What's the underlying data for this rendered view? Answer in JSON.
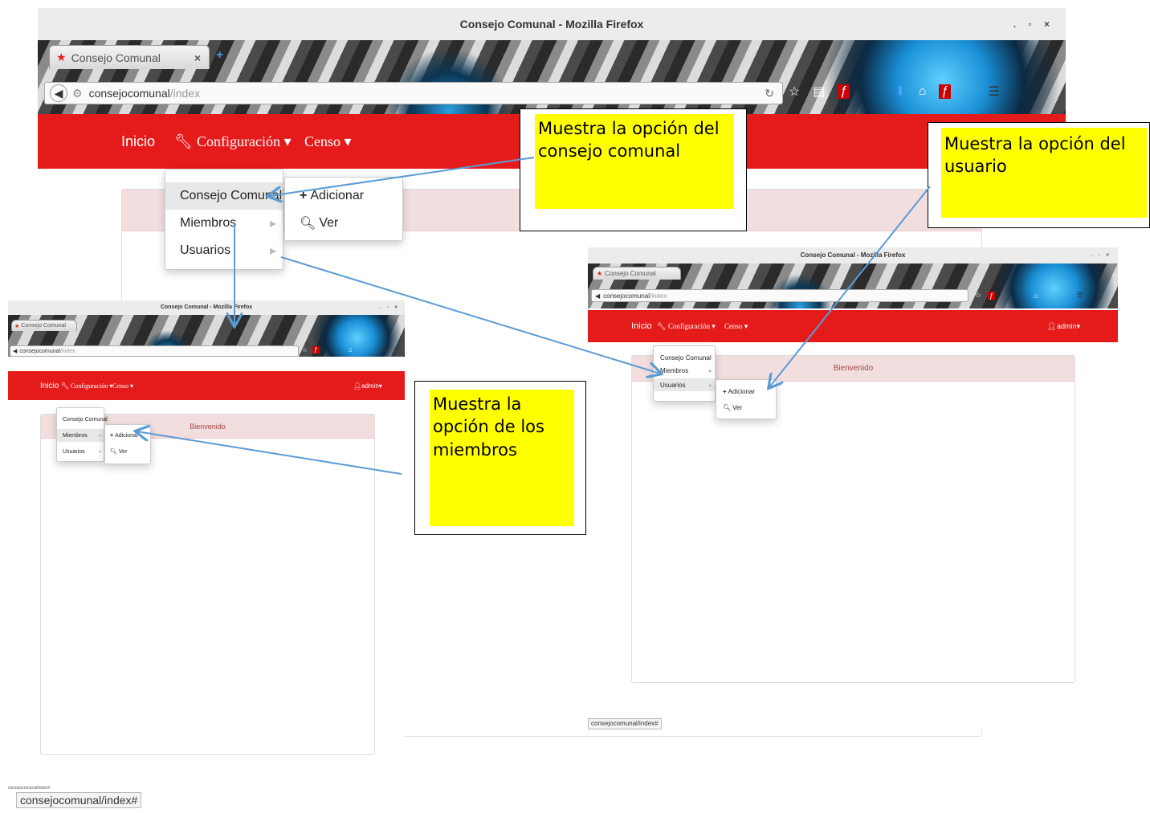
{
  "browser": {
    "window_title": "Consejo Comunal - Mozilla Firefox",
    "window_controls": ". ▫ ×",
    "tab_title": "Consejo Comunal",
    "url_base": "consejocomunal",
    "url_path": "/index"
  },
  "navbar": {
    "inicio": "Inicio",
    "configuracion": "Configuración ▾",
    "censo": "Censo ▾",
    "user": "admin▾"
  },
  "menu": {
    "consejo_comunal": "Consejo Comunal",
    "miembros": "Miembros",
    "usuarios": "Usuarios"
  },
  "submenu": {
    "adicionar": "Adicionar",
    "ver": "Ver"
  },
  "panel": {
    "welcome": "Bienvenido"
  },
  "status": {
    "url": "consejocomunal/index#"
  },
  "callouts": {
    "consejo": "Muestra la opción del consejo comunal",
    "usuario": "Muestra la opción del usuario",
    "miembros": "Muestra la opción de los miembros"
  },
  "colors": {
    "navbar": "#e51b1b",
    "callout": "#ffff00",
    "arrow": "#5b9bd5",
    "panel_head": "#f2dede"
  }
}
